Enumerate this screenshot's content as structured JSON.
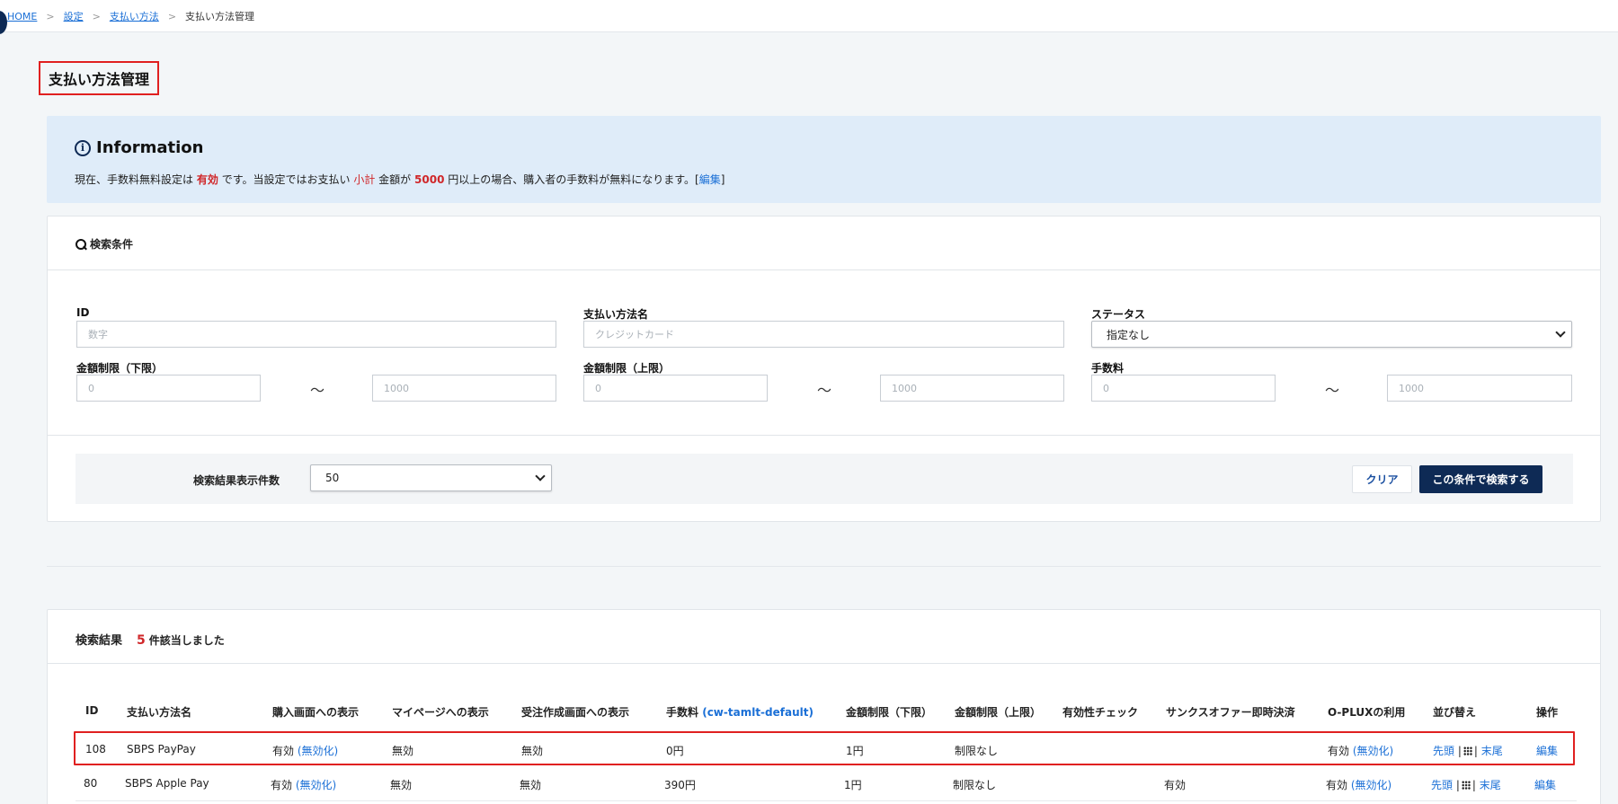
{
  "breadcrumb": {
    "home": "HOME",
    "settings": "設定",
    "payment_methods": "支払い方法",
    "current": "支払い方法管理",
    "sep": ">"
  },
  "page_title": "支払い方法管理",
  "info": {
    "title": "Information",
    "text_1": "現在、手数料無料設定は",
    "status": "有効",
    "text_2": "です。当設定ではお支払い",
    "subtotal": "小計",
    "text_3": "金額が",
    "amount": "5000",
    "text_4": "円以上の場合、購入者の手数料が無料になります。[",
    "edit_link": "編集",
    "text_5": "]"
  },
  "search": {
    "header": "検索条件",
    "id_label": "ID",
    "id_placeholder": "数字",
    "name_label": "支払い方法名",
    "name_placeholder": "クレジットカード",
    "status_label": "ステータス",
    "status_value": "指定なし",
    "min_label": "金額制限（下限）",
    "max_label": "金額制限（上限）",
    "fee_label": "手数料",
    "range_from_placeholder": "0",
    "range_to_placeholder": "1000",
    "tilde": "～",
    "count_label": "検索結果表示件数",
    "count_value": "50",
    "clear_button": "クリア",
    "search_button": "この条件で検索する"
  },
  "results": {
    "title": "検索結果",
    "count": "5",
    "suffix": "件該当しました",
    "headers": {
      "id": "ID",
      "name": "支払い方法名",
      "purchase": "購入画面への表示",
      "mypage": "マイページへの表示",
      "order": "受注作成画面への表示",
      "fee": "手数料",
      "fee_link": "(cw-tamlt-default)",
      "min": "金額制限（下限）",
      "max": "金額制限（上限）",
      "validity": "有効性チェック",
      "thanks": "サンクスオファー即時決済",
      "oplux": "O-PLUXの利用",
      "sort": "並び替え",
      "ops": "操作"
    },
    "rows": [
      {
        "id": "108",
        "name": "SBPS PayPay",
        "purchase": "有効",
        "purchase_link": "(無効化)",
        "mypage": "無効",
        "order": "無効",
        "fee": "0円",
        "min": "1円",
        "max": "制限なし",
        "validity": "",
        "thanks": "",
        "oplux": "有効",
        "oplux_link": "(無効化)",
        "sort_first": "先頭",
        "sort_sep": "|",
        "sort_last": "末尾",
        "edit": "編集"
      },
      {
        "id": "80",
        "name": "SBPS Apple Pay",
        "purchase": "有効",
        "purchase_link": "(無効化)",
        "mypage": "無効",
        "order": "無効",
        "fee": "390円",
        "min": "1円",
        "max": "制限なし",
        "validity": "",
        "thanks": "有効",
        "oplux": "有効",
        "oplux_link": "(無効化)",
        "sort_first": "先頭",
        "sort_sep": "|",
        "sort_last": "末尾",
        "edit": "編集"
      }
    ]
  },
  "colors": {
    "accent": "#0e2a55",
    "link": "#1a6fd6",
    "alert": "#d0272a",
    "highlight_border": "#e02020",
    "info_bg": "#dfecf9"
  }
}
